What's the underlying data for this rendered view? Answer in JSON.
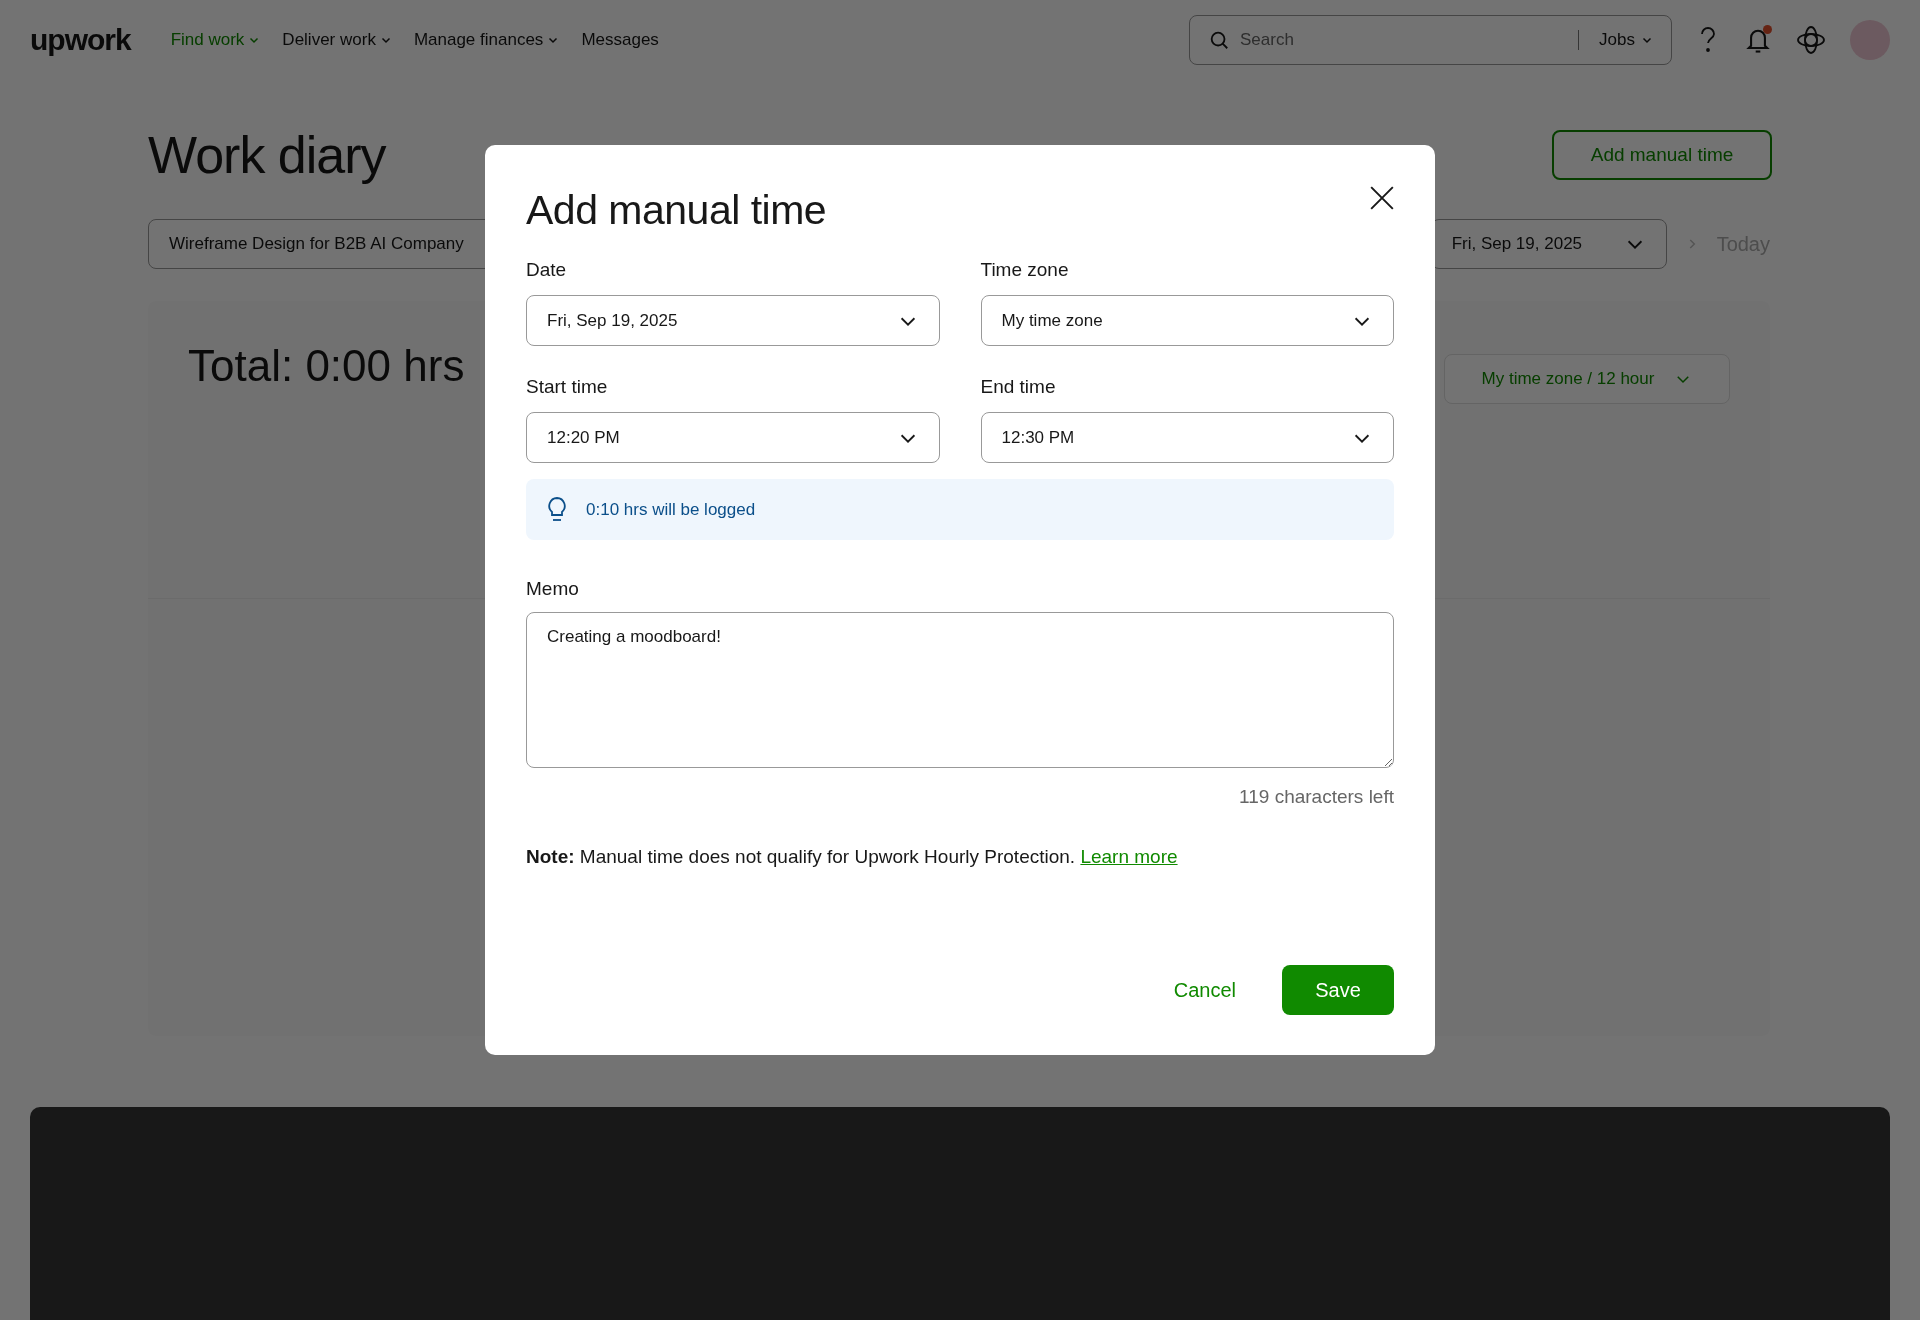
{
  "nav": {
    "logo": "upwork",
    "items": [
      {
        "label": "Find work",
        "selected": true,
        "dropdown": true
      },
      {
        "label": "Deliver work",
        "selected": false,
        "dropdown": true
      },
      {
        "label": "Manage finances",
        "selected": false,
        "dropdown": true
      },
      {
        "label": "Messages",
        "selected": false,
        "dropdown": false
      }
    ],
    "search": {
      "placeholder": "Search",
      "scope": "Jobs"
    },
    "notification_badge": true
  },
  "page": {
    "title": "Work diary",
    "add_button": "Add manual time",
    "contract": "Wireframe Design for B2B AI Company",
    "date": "Fri, Sep 19, 2025",
    "today": {
      "label": "Today",
      "disabled": true
    },
    "total": "Total: 0:00 hrs",
    "timezone_button": "My time zone / 12 hour"
  },
  "modal": {
    "title": "Add manual time",
    "fields": [
      {
        "label": "Date",
        "value": "Fri, Sep 19, 2025"
      },
      {
        "label": "Time zone",
        "value": "My time zone"
      },
      {
        "label": "Start time",
        "value": "12:20 PM"
      },
      {
        "label": "End time",
        "value": "12:30 PM"
      }
    ],
    "info": "0:10 hrs will be logged",
    "memo": {
      "label": "Memo",
      "value": "Creating a moodboard!"
    },
    "chars_left": "119 characters left",
    "note": "**Note:** Manual time does not qualify for Upwork Hourly Protection.",
    "note_link": "Learn more",
    "cancel": "Cancel",
    "save": "Save"
  }
}
